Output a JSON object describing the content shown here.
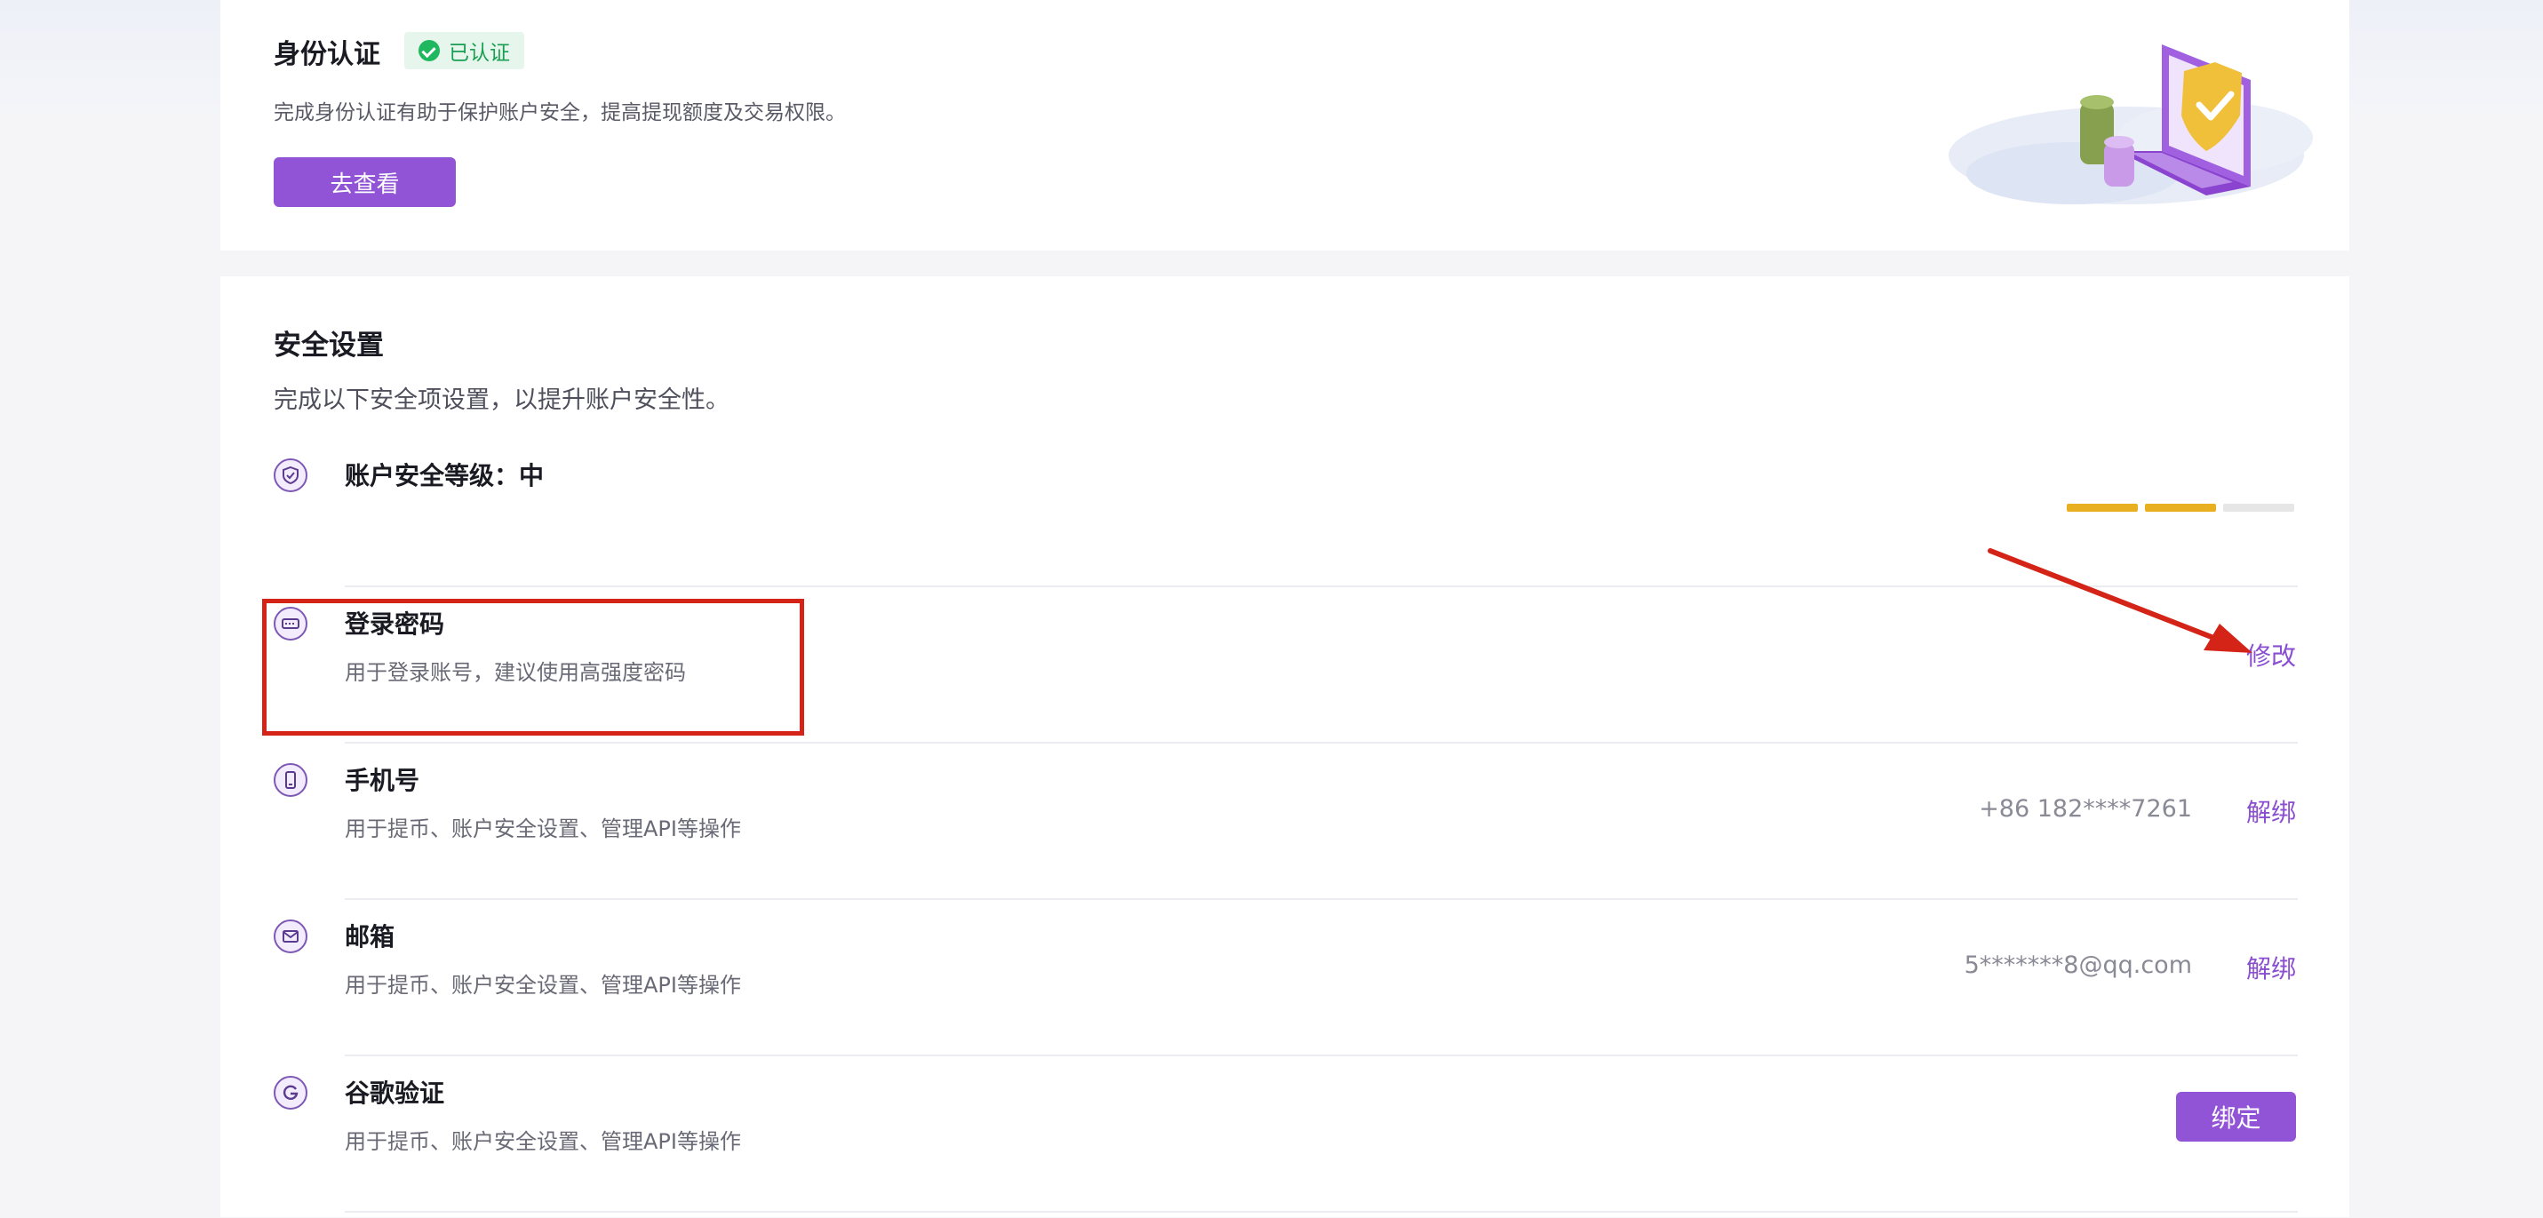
{
  "identity": {
    "title": "身份认证",
    "badge": "已认证",
    "description": "完成身份认证有助于保护账户安全，提高提现额度及交易权限。",
    "button": "去查看"
  },
  "security": {
    "title": "安全设置",
    "description": "完成以下安全项设置，以提升账户安全性。",
    "level": {
      "label": "账户安全等级：",
      "value": "中",
      "filled_segments": 2,
      "total_segments": 3
    },
    "items": [
      {
        "title": "登录密码",
        "subtitle": "用于登录账号，建议使用高强度密码",
        "value": "",
        "action": "修改",
        "icon": "keyboard-icon"
      },
      {
        "title": "手机号",
        "subtitle": "用于提币、账户安全设置、管理API等操作",
        "value": "+86 182****7261",
        "action": "解绑",
        "icon": "phone-icon"
      },
      {
        "title": "邮箱",
        "subtitle": "用于提币、账户安全设置、管理API等操作",
        "value": "5*******8@qq.com",
        "action": "解绑",
        "icon": "mail-icon"
      },
      {
        "title": "谷歌验证",
        "subtitle": "用于提币、账户安全设置、管理API等操作",
        "value": "",
        "action": "绑定",
        "icon": "google-icon"
      }
    ]
  },
  "colors": {
    "accent": "#9254d6",
    "level_filled": "#e8b020",
    "level_empty": "#e6e6e6",
    "verified": "#1fb85e",
    "annotation": "#d42418"
  }
}
